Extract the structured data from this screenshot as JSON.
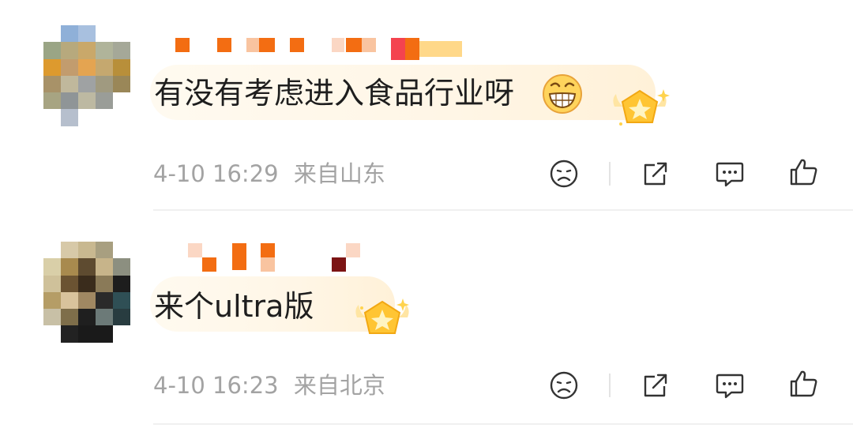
{
  "comments": [
    {
      "text": "有没有考虑进入食品行业呀",
      "time": "4-10 16:29",
      "location": "来自山东",
      "emoji": "grinning-face-emoji",
      "badge": "star-medal-icon"
    },
    {
      "text": "来个ultra版",
      "time": "4-10 16:23",
      "location": "来自北京",
      "emoji": "",
      "badge": "star-medal-icon"
    }
  ],
  "actions": {
    "icons": [
      "unhappy-face-icon",
      "share-icon",
      "reply-icon",
      "like-icon"
    ]
  },
  "colors": {
    "text": "#1e1e1e",
    "meta": "#a3a3a3",
    "icon": "#333333",
    "name_blocks": "#f36d12",
    "bubble": "#fff5e4"
  }
}
